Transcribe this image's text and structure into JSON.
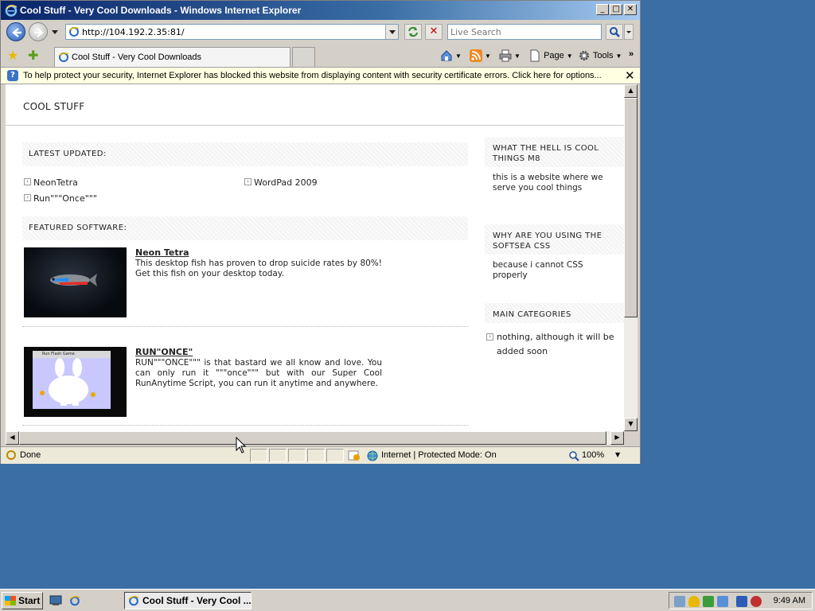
{
  "window": {
    "title": "Cool Stuff - Very Cool Downloads - Windows Internet Explorer",
    "minimize": "0",
    "maximize": "1",
    "close": "r"
  },
  "address_bar": {
    "url": "http://104.192.2.35:81/",
    "search_placeholder": "Live Search"
  },
  "tabs": {
    "active_label": "Cool Stuff - Very Cool Downloads"
  },
  "command_bar": {
    "page_label": "Page",
    "tools_label": "Tools",
    "chevron": "»"
  },
  "info_bar": {
    "message": "To help protect your security, Internet Explorer has blocked this website from displaying content with security certificate errors. Click here for options...",
    "close": "✕"
  },
  "site": {
    "title": "COOL STUFF",
    "latest_heading": "LATEST UPDATED:",
    "latest_items": [
      "NeonTetra",
      "WordPad 2009",
      "Run\"\"\"Once\"\"\""
    ],
    "featured_heading": "FEATURED SOFTWARE:",
    "featured": [
      {
        "title": "Neon Tetra",
        "description": "This desktop fish has proven to drop suicide rates by 80%! Get this fish on your desktop today."
      },
      {
        "title": "RUN\"ONCE\"",
        "description": "RUN\"\"\"ONCE\"\"\" is that bastard we all know and love. You can only run it \"\"\"once\"\"\" but with our Super Cool RunAnytime Script, you can run it anytime and anywhere.",
        "thumb_caption": "Run Flash Game"
      }
    ],
    "sidebar": [
      {
        "heading": "WHAT THE HELL IS COOL THINGS M8",
        "text": "this is a website where we serve you cool things"
      },
      {
        "heading": "WHY ARE YOU USING THE SOFTSEA CSS",
        "text": "because i cannot CSS properly"
      },
      {
        "heading": "MAIN CATEGORIES",
        "text": "nothing, although it will be added soon"
      }
    ]
  },
  "status_bar": {
    "status": "Done",
    "zone": "Internet | Protected Mode: On",
    "zoom": "100%"
  },
  "taskbar": {
    "start_label": "Start",
    "task_label": "Cool Stuff - Very Cool ...",
    "clock": "9:49 AM"
  },
  "colors": {
    "desktop": "#3a6ea5",
    "titlebar": "#0a246a",
    "info_bar": "#ffffe1"
  }
}
